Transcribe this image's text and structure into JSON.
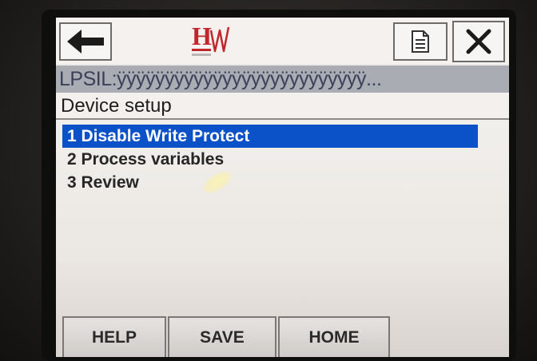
{
  "toolbar": {
    "back_icon": "left-arrow",
    "logo_text": "H",
    "document_icon": "document",
    "close_icon": "x"
  },
  "path_label": "LPSIL:ÿÿÿÿÿÿÿÿÿÿÿÿÿÿÿÿÿÿÿÿÿÿÿÿÿÿ...",
  "page_title": "Device setup",
  "menu": {
    "items": [
      {
        "label": "1 Disable Write Protect",
        "selected": true
      },
      {
        "label": "2 Process variables",
        "selected": false
      },
      {
        "label": "3 Review",
        "selected": false
      }
    ]
  },
  "soft_keys": {
    "help": "HELP",
    "save": "SAVE",
    "home": "HOME"
  },
  "colors": {
    "selection": "#0b52c8",
    "logo_red": "#c0272d",
    "path_bar": "#a9acb2"
  }
}
